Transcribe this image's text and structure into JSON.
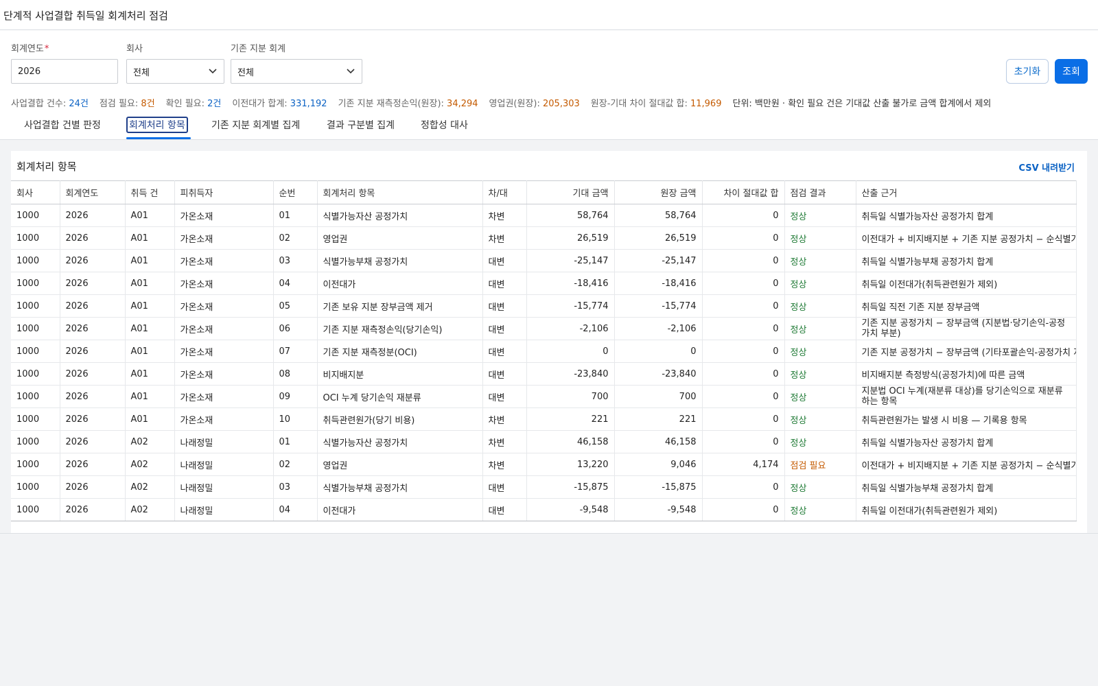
{
  "header": {
    "title": "단계적 사업결합 취득일 회계처리 점검"
  },
  "filters": {
    "year_label": "회계연도",
    "year_required": "*",
    "year_value": "2026",
    "company_label": "회사",
    "company_value": "전체",
    "equity_label": "기존 지분 회계",
    "equity_value": "전체",
    "reset_label": "초기화",
    "search_label": "조회"
  },
  "summary": {
    "count_label": "사업결합 건수: ",
    "count_value": "24건",
    "check_label": "점검 필요: ",
    "check_value": "8건",
    "confirm_label": "확인 필요: ",
    "confirm_value": "2건",
    "consideration_label": "이전대가 합계: ",
    "consideration_value": "331,192",
    "remeasure_label": "기존 지분 재측정손익(원장): ",
    "remeasure_value": "34,294",
    "goodwill_label": "영업권(원장): ",
    "goodwill_value": "205,303",
    "diff_label": "원장-기대 차이 절대값 합: ",
    "diff_value": "11,969",
    "note": "단위: 백만원 · 확인 필요 건은 기대값 산출 불가로 금액 합계에서 제외"
  },
  "tabs": [
    {
      "label": "사업결합 건별 판정"
    },
    {
      "label": "회계처리 항목"
    },
    {
      "label": "기존 지분 회계별 집계"
    },
    {
      "label": "결과 구분별 집계"
    },
    {
      "label": "정합성 대사"
    }
  ],
  "panel": {
    "title": "회계처리 항목",
    "csv_label": "CSV 내려받기"
  },
  "table": {
    "columns": [
      "회사",
      "회계연도",
      "취득 건",
      "피취득자",
      "순번",
      "회계처리 항목",
      "차/대",
      "기대 금액",
      "원장 금액",
      "차이 절대값 합",
      "점검 결과",
      "산출 근거"
    ],
    "rows": [
      [
        "1000",
        "2026",
        "A01",
        "가온소재",
        "01",
        "식별가능자산 공정가치",
        "차변",
        "58,764",
        "58,764",
        "0",
        "정상",
        "취득일 식별가능자산 공정가치 합계"
      ],
      [
        "1000",
        "2026",
        "A01",
        "가온소재",
        "02",
        "영업권",
        "차변",
        "26,519",
        "26,519",
        "0",
        "정상",
        "이전대가 + 비지배지분 + 기존 지분 공정가치 − 순식별가능자산"
      ],
      [
        "1000",
        "2026",
        "A01",
        "가온소재",
        "03",
        "식별가능부채 공정가치",
        "대변",
        "-25,147",
        "-25,147",
        "0",
        "정상",
        "취득일 식별가능부채 공정가치 합계"
      ],
      [
        "1000",
        "2026",
        "A01",
        "가온소재",
        "04",
        "이전대가",
        "대변",
        "-18,416",
        "-18,416",
        "0",
        "정상",
        "취득일 이전대가(취득관련원가 제외)"
      ],
      [
        "1000",
        "2026",
        "A01",
        "가온소재",
        "05",
        "기존 보유 지분 장부금액 제거",
        "대변",
        "-15,774",
        "-15,774",
        "0",
        "정상",
        "취득일 직전 기존 지분 장부금액"
      ],
      [
        "1000",
        "2026",
        "A01",
        "가온소재",
        "06",
        "기존 지분 재측정손익(당기손익)",
        "대변",
        "-2,106",
        "-2,106",
        "0",
        "정상",
        "기존 지분 공정가치 − 장부금액 (지분법·당기손익-공정가치 부분)"
      ],
      [
        "1000",
        "2026",
        "A01",
        "가온소재",
        "07",
        "기존 지분 재측정분(OCI)",
        "대변",
        "0",
        "0",
        "0",
        "정상",
        "기존 지분 공정가치 − 장부금액 (기타포괄손익-공정가치 지분)"
      ],
      [
        "1000",
        "2026",
        "A01",
        "가온소재",
        "08",
        "비지배지분",
        "대변",
        "-23,840",
        "-23,840",
        "0",
        "정상",
        "비지배지분 측정방식(공정가치)에 따른 금액"
      ],
      [
        "1000",
        "2026",
        "A01",
        "가온소재",
        "09",
        "OCI 누계 당기손익 재분류",
        "대변",
        "700",
        "700",
        "0",
        "정상",
        "지분법 OCI 누계(재분류 대상)를 당기손익으로 재분류하는 항목"
      ],
      [
        "1000",
        "2026",
        "A01",
        "가온소재",
        "10",
        "취득관련원가(당기 비용)",
        "차변",
        "221",
        "221",
        "0",
        "정상",
        "취득관련원가는 발생 시 비용 — 기록용 항목"
      ],
      [
        "1000",
        "2026",
        "A02",
        "나래정밀",
        "01",
        "식별가능자산 공정가치",
        "차변",
        "46,158",
        "46,158",
        "0",
        "정상",
        "취득일 식별가능자산 공정가치 합계"
      ],
      [
        "1000",
        "2026",
        "A02",
        "나래정밀",
        "02",
        "영업권",
        "차변",
        "13,220",
        "9,046",
        "4,174",
        "점검 필요",
        "이전대가 + 비지배지분 + 기존 지분 공정가치 − 순식별가능자산"
      ],
      [
        "1000",
        "2026",
        "A02",
        "나래정밀",
        "03",
        "식별가능부채 공정가치",
        "대변",
        "-15,875",
        "-15,875",
        "0",
        "정상",
        "취득일 식별가능부채 공정가치 합계"
      ],
      [
        "1000",
        "2026",
        "A02",
        "나래정밀",
        "04",
        "이전대가",
        "대변",
        "-9,548",
        "-9,548",
        "0",
        "정상",
        "취득일 이전대가(취득관련원가 제외)"
      ]
    ]
  },
  "colors": {
    "accent": "#0a6ee6",
    "ok": "#1f7a35",
    "warn": "#c45a00",
    "link": "#0b62c4"
  }
}
